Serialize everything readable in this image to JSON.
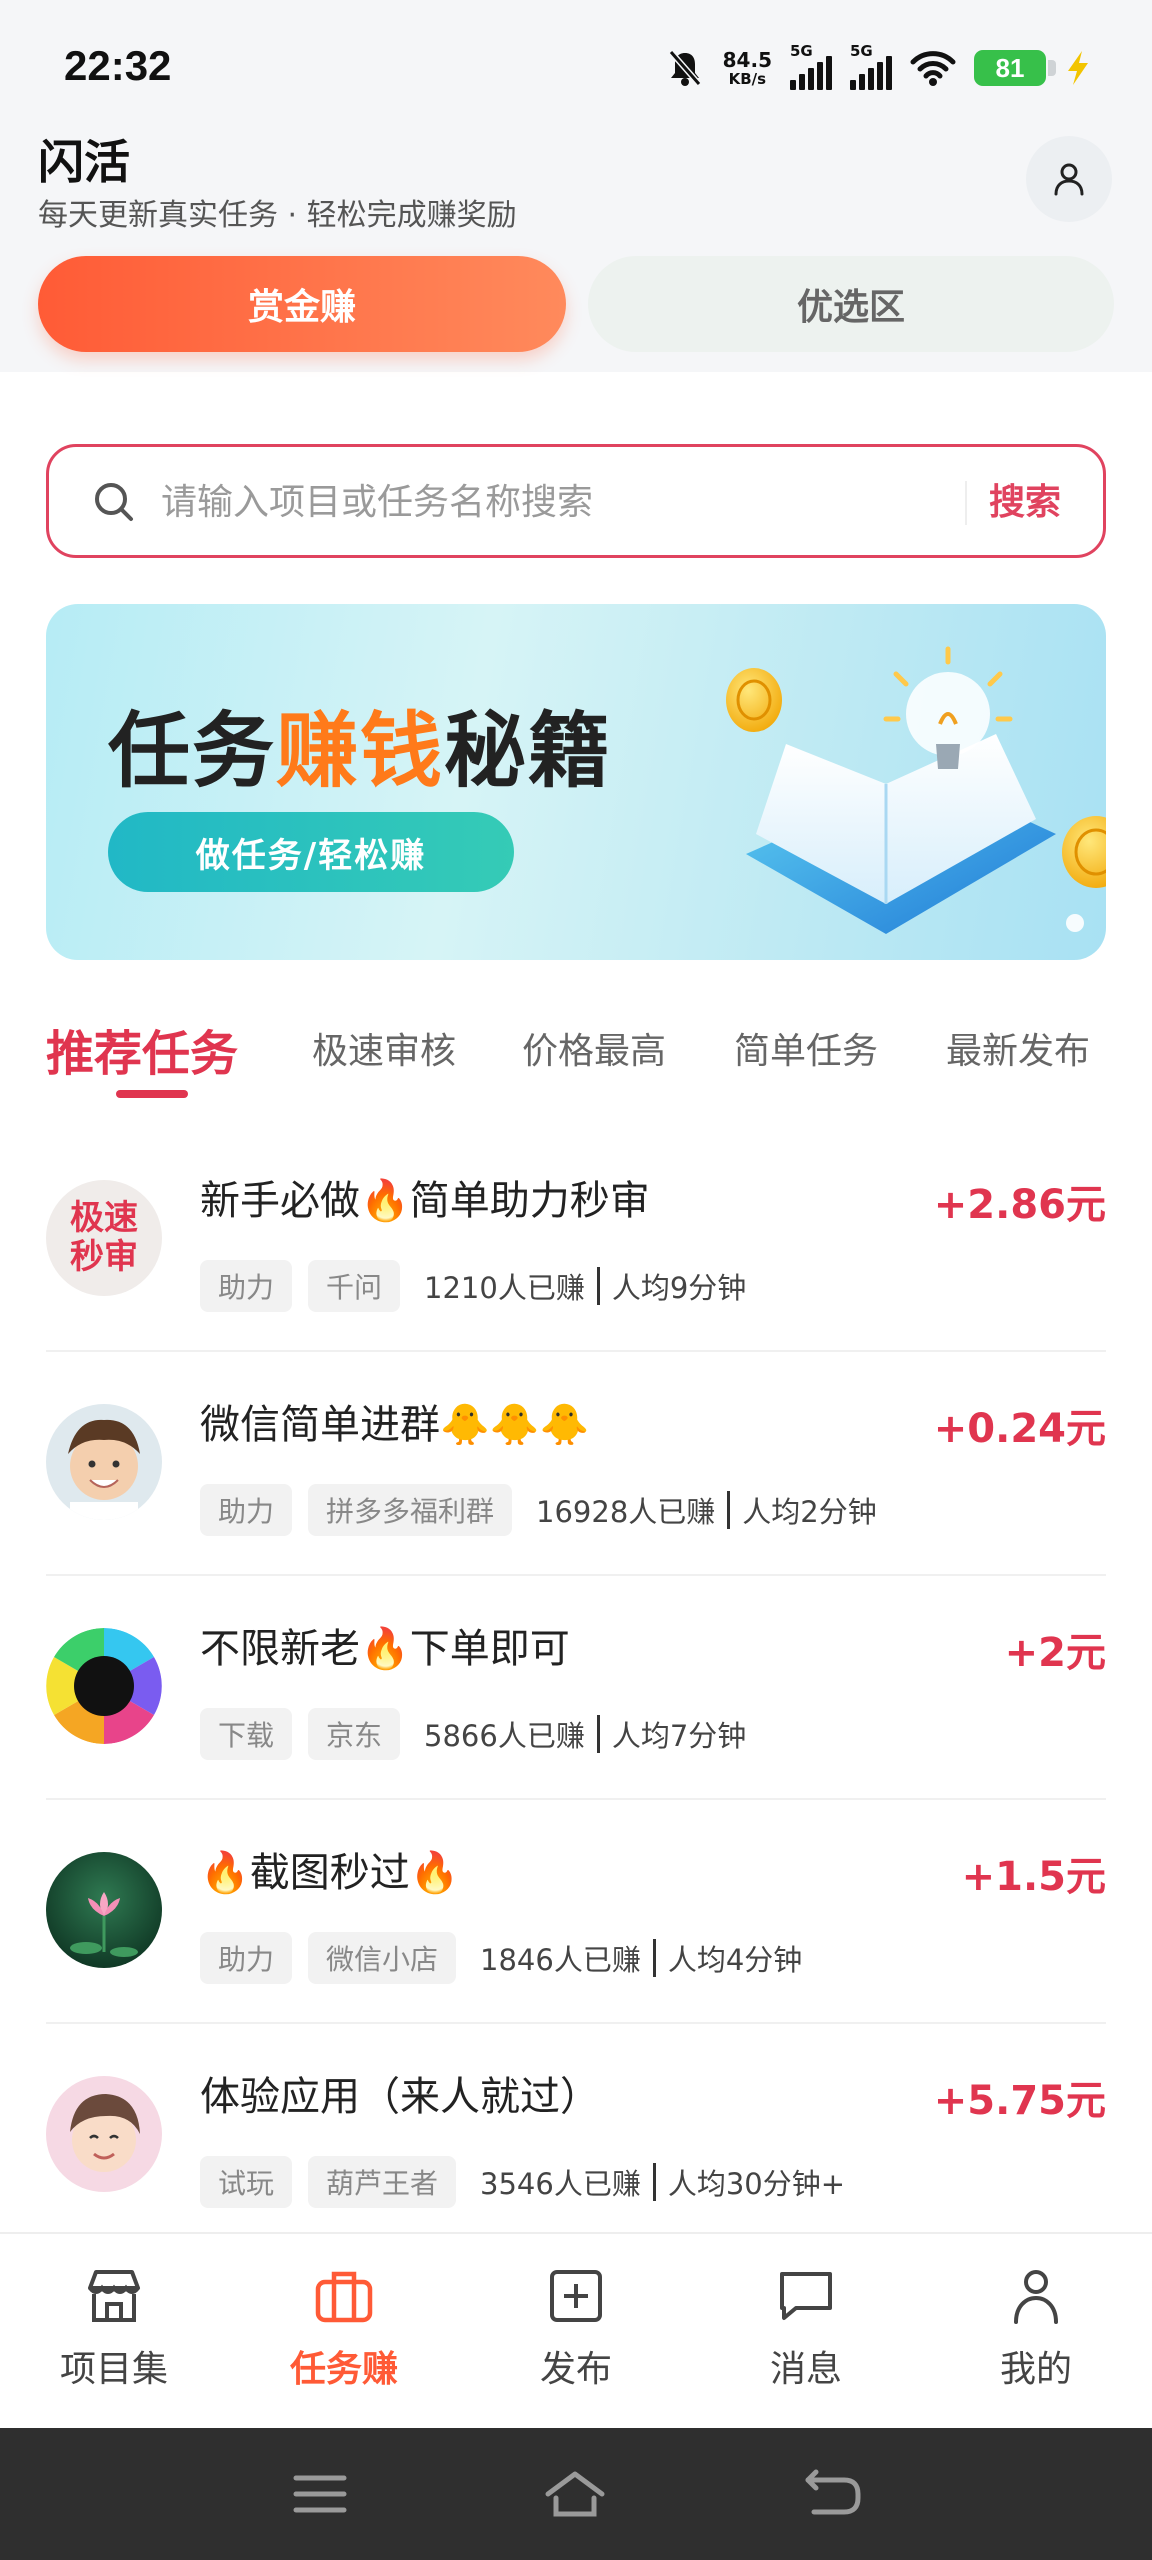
{
  "status_bar": {
    "time": "22:32",
    "net_speed_value": "84.5",
    "net_speed_unit": "KB/s",
    "signal1_label": "5G",
    "signal2_label": "5G",
    "battery": "81",
    "icons": [
      "mute-bell-icon",
      "signal-icon",
      "signal-icon",
      "wifi-icon",
      "battery-icon",
      "charging-icon"
    ]
  },
  "header": {
    "title": "闪活",
    "subtitle": "每天更新真实任务 · 轻松完成赚奖励",
    "profile_icon": "user-icon"
  },
  "segments": {
    "left_label": "赏金赚",
    "right_label": "优选区",
    "active": "left"
  },
  "search": {
    "placeholder": "请输入项目或任务名称搜索",
    "button_label": "搜索"
  },
  "banner": {
    "title_part1": "任务",
    "title_part2": "赚钱",
    "title_part3": "秘籍",
    "pill": "做任务/轻松赚"
  },
  "tabs": [
    {
      "label": "推荐任务",
      "active": true
    },
    {
      "label": "极速审核",
      "active": false
    },
    {
      "label": "价格最高",
      "active": false
    },
    {
      "label": "简单任务",
      "active": false
    },
    {
      "label": "最新发布",
      "active": false
    }
  ],
  "tasks": [
    {
      "avatar_text_1": "极速",
      "avatar_text_2": "秒审",
      "title": "新手必做🔥简单助力秒审",
      "reward": "+2.86元",
      "tags": [
        "助力",
        "千问"
      ],
      "earned": "1210人已赚",
      "avg_time": "人均9分钟"
    },
    {
      "title": "微信简单进群🐥🐥🐥",
      "reward": "+0.24元",
      "tags": [
        "助力",
        "拼多多福利群"
      ],
      "earned": "16928人已赚",
      "avg_time": "人均2分钟"
    },
    {
      "title": "不限新老🔥下单即可",
      "reward": "+2元",
      "tags": [
        "下载",
        "京东"
      ],
      "earned": "5866人已赚",
      "avg_time": "人均7分钟"
    },
    {
      "title": "🔥截图秒过🔥",
      "reward": "+1.5元",
      "tags": [
        "助力",
        "微信小店"
      ],
      "earned": "1846人已赚",
      "avg_time": "人均4分钟"
    },
    {
      "title": "体验应用（来人就过）",
      "reward": "+5.75元",
      "tags": [
        "试玩",
        "葫芦王者"
      ],
      "earned": "3546人已赚",
      "avg_time": "人均30分钟+"
    }
  ],
  "bottom_nav": [
    {
      "label": "项目集",
      "icon": "store-icon",
      "active": false
    },
    {
      "label": "任务赚",
      "icon": "briefcase-icon",
      "active": true
    },
    {
      "label": "发布",
      "icon": "plus-square-icon",
      "active": false
    },
    {
      "label": "消息",
      "icon": "message-icon",
      "active": false
    },
    {
      "label": "我的",
      "icon": "user-icon",
      "active": false
    }
  ],
  "colors": {
    "accent_red": "#e0354f",
    "accent_orange": "#ff5a36",
    "banner_teal": "#21b8c6"
  }
}
